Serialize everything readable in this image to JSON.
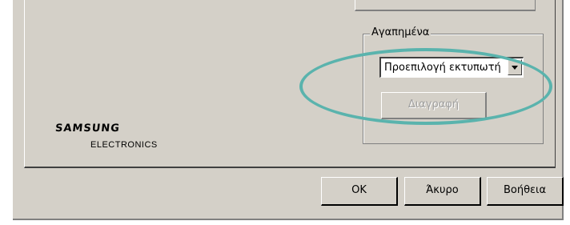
{
  "groupbox": {
    "label": "Αγαπημένα",
    "select_value": "Προεπιλογή εκτυπωτή",
    "delete_label": "Διαγραφή"
  },
  "logo": {
    "main": "SAMSUNG",
    "sub": "ELECTRONICS"
  },
  "footer": {
    "ok_label": "OK",
    "cancel_label": "Άκυρο",
    "help_label": "Βοήθεια"
  },
  "colors": {
    "dialog_bg": "#d4d0c8",
    "highlight": "#5ab3ad"
  }
}
